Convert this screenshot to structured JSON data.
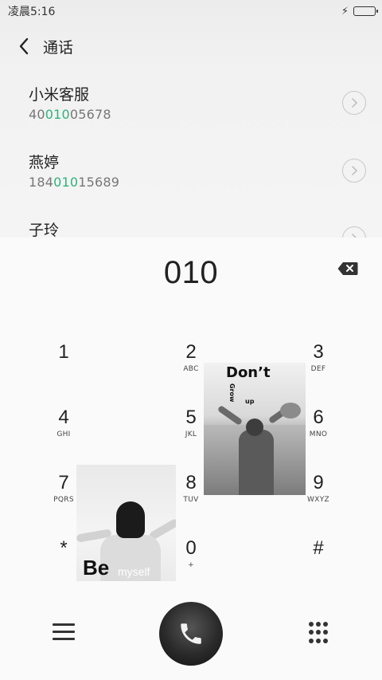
{
  "status": {
    "time": "凌晨5:16"
  },
  "header": {
    "title": "通话"
  },
  "contacts": [
    {
      "name": "小米客服",
      "number_pre": "40",
      "number_hl": "010",
      "number_post": "05678"
    },
    {
      "name": "燕婷",
      "number_pre": "184",
      "number_hl": "010",
      "number_post": "15689"
    },
    {
      "name": "子玲"
    }
  ],
  "dialer": {
    "input": "010",
    "keys": [
      {
        "digit": "1",
        "letters": ""
      },
      {
        "digit": "2",
        "letters": "ABC"
      },
      {
        "digit": "3",
        "letters": "DEF"
      },
      {
        "digit": "4",
        "letters": "GHI"
      },
      {
        "digit": "5",
        "letters": "JKL"
      },
      {
        "digit": "6",
        "letters": "MNO"
      },
      {
        "digit": "7",
        "letters": "PQRS"
      },
      {
        "digit": "8",
        "letters": "TUV"
      },
      {
        "digit": "9",
        "letters": "WXYZ"
      },
      {
        "digit": "*",
        "letters": ""
      },
      {
        "digit": "0",
        "letters": "+"
      },
      {
        "digit": "#",
        "letters": ""
      }
    ]
  },
  "photos": {
    "dont": {
      "line1": "Don’t",
      "line2": "Grow",
      "line3": "up"
    },
    "be": {
      "line1": "Be",
      "line2": "myself"
    }
  },
  "colors": {
    "highlight": "#2fb37a",
    "accent": "#333333"
  },
  "icons": {
    "back": "chevron-left-icon",
    "arrow": "chevron-right-circle-icon",
    "backspace": "backspace-icon",
    "menu": "menu-icon",
    "call": "phone-icon",
    "keypad": "keypad-icon"
  }
}
